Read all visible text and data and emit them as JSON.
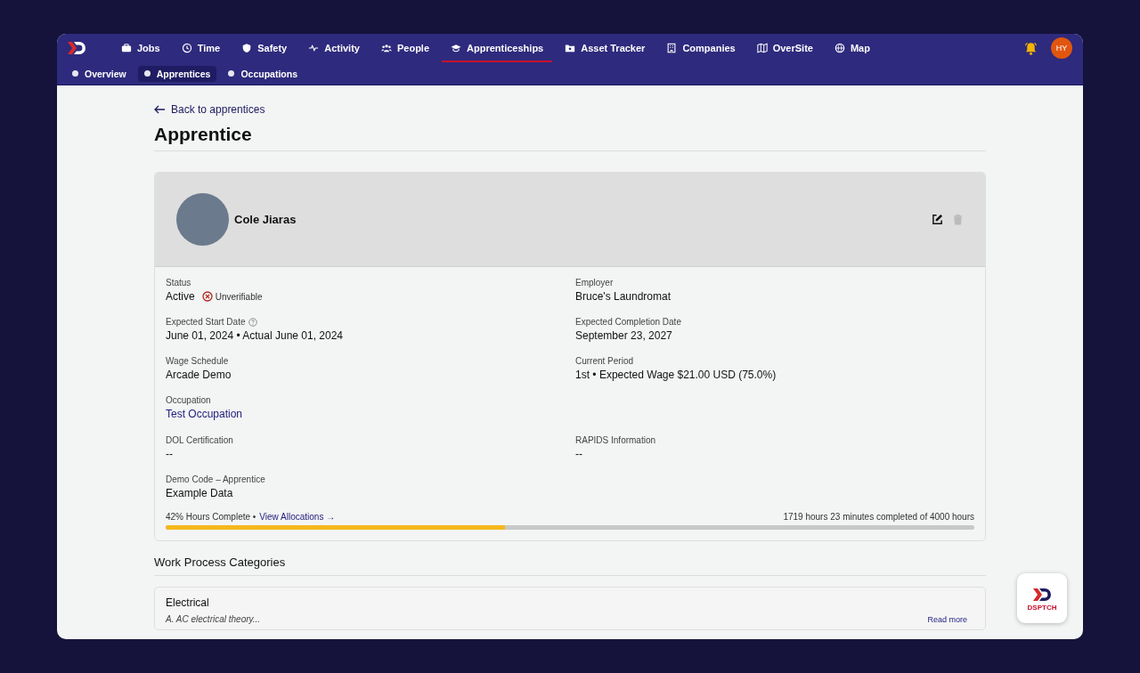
{
  "nav": {
    "items": [
      {
        "label": "Jobs",
        "selected": false
      },
      {
        "label": "Time",
        "selected": false
      },
      {
        "label": "Safety",
        "selected": false
      },
      {
        "label": "Activity",
        "selected": false
      },
      {
        "label": "People",
        "selected": false
      },
      {
        "label": "Apprenticeships",
        "selected": true
      },
      {
        "label": "Asset Tracker",
        "selected": false
      },
      {
        "label": "Companies",
        "selected": false
      },
      {
        "label": "OverSite",
        "selected": false
      },
      {
        "label": "Map",
        "selected": false
      }
    ],
    "avatar": "HY"
  },
  "subnav": [
    {
      "label": "Overview",
      "selected": false
    },
    {
      "label": "Apprentices",
      "selected": true
    },
    {
      "label": "Occupations",
      "selected": false
    }
  ],
  "back_link": "Back to apprentices",
  "page_title": "Apprentice",
  "profile": {
    "name": "Cole Jiaras",
    "rows": [
      {
        "fields": [
          {
            "label": "Status",
            "value": "Active",
            "kind": "status",
            "badge": "Unverifiable"
          },
          {
            "label": "Employer",
            "value": "Bruce's Laundromat",
            "kind": "text"
          }
        ]
      },
      {
        "fields": [
          {
            "label": "Expected Start Date",
            "value": "June 01, 2024 • Actual June 01, 2024",
            "kind": "help"
          },
          {
            "label": "Expected Completion Date",
            "value": "September 23, 2027",
            "kind": "text"
          }
        ]
      },
      {
        "fields": [
          {
            "label": "Wage Schedule",
            "value": "Arcade Demo",
            "kind": "text"
          },
          {
            "label": "Current Period",
            "value": "1st • Expected Wage $21.00 USD (75.0%)",
            "kind": "text"
          }
        ]
      },
      {
        "fields": [
          {
            "label": "Occupation",
            "value": "Test Occupation",
            "kind": "link"
          }
        ]
      },
      {
        "fields": [
          {
            "label": "DOL Certification",
            "value": "--",
            "kind": "text"
          },
          {
            "label": "RAPIDS Information",
            "value": "--",
            "kind": "text"
          }
        ]
      },
      {
        "fields": [
          {
            "label": "Demo Code – Apprentice",
            "value": "Example Data",
            "kind": "text"
          }
        ]
      }
    ],
    "progress": {
      "percent_text": "42% Hours Complete •",
      "link": "View Allocations →",
      "summary": "1719 hours 23 minutes completed of 4000 hours",
      "level": 0.42
    }
  },
  "section_title": "Work Process Categories",
  "categories": [
    {
      "title": "Electrical",
      "description": "A. AC electrical theory...",
      "link": "Read more"
    }
  ],
  "floating_badge": {
    "text": "DSPTCH"
  }
}
